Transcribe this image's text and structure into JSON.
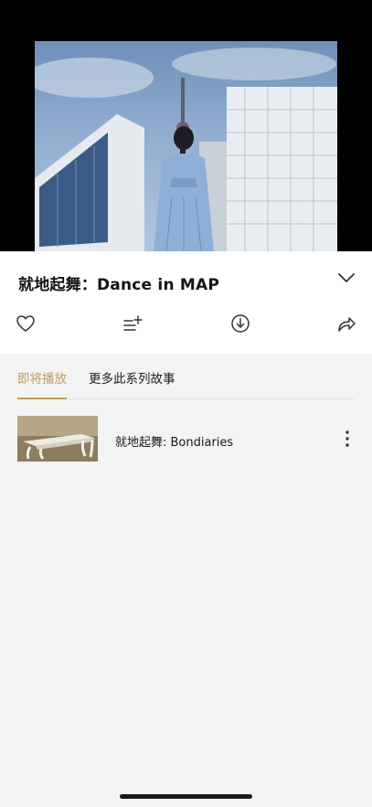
{
  "video": {
    "state": "cover"
  },
  "episode": {
    "title": "就地起舞：Dance in MAP"
  },
  "icons": {
    "collapse": "chevron-down-icon",
    "like": "heart-icon",
    "add_to_list": "add-to-playlist-icon",
    "download": "download-icon",
    "share": "share-icon",
    "more": "more-vertical-icon"
  },
  "tabs": [
    {
      "label": "即将播放",
      "active": true
    },
    {
      "label": "更多此系列故事",
      "active": false
    }
  ],
  "up_next": [
    {
      "title": "就地起舞: Bondiaries"
    }
  ],
  "colors": {
    "accent": "#c29a5e",
    "background": "#f3f3f3",
    "panel": "#ffffff",
    "text": "#141414"
  }
}
